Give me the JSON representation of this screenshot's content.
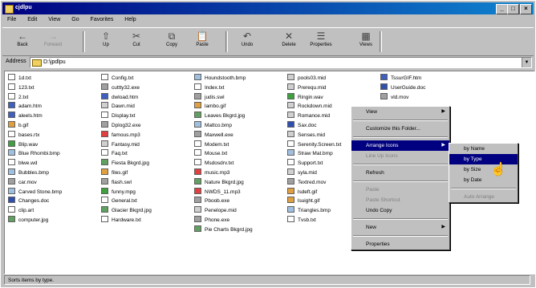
{
  "window": {
    "title": "cjdlpu"
  },
  "titlebar_buttons": [
    "_",
    "□",
    "×"
  ],
  "menubar": [
    "File",
    "Edit",
    "View",
    "Go",
    "Favorites",
    "Help"
  ],
  "toolbar": [
    {
      "label": "Back",
      "glyph": "←",
      "disabled": false
    },
    {
      "label": "Forward",
      "glyph": "→",
      "disabled": true
    },
    {
      "label": "Up",
      "glyph": "⇧",
      "disabled": false
    },
    {
      "label": "Cut",
      "glyph": "✂",
      "disabled": false
    },
    {
      "label": "Copy",
      "glyph": "⧉",
      "disabled": false
    },
    {
      "label": "Paste",
      "glyph": "📋",
      "disabled": false
    },
    {
      "label": "Undo",
      "glyph": "↶",
      "disabled": false
    },
    {
      "label": "Delete",
      "glyph": "✕",
      "disabled": false
    },
    {
      "label": "Properties",
      "glyph": "☰",
      "disabled": false
    },
    {
      "label": "Views",
      "glyph": "▦",
      "disabled": false
    }
  ],
  "address": {
    "label": "Address",
    "value": "D:\\jpdlpu"
  },
  "files": [
    [
      {
        "name": "1d.txt",
        "type": "txt"
      },
      {
        "name": "123.txt",
        "type": "txt"
      },
      {
        "name": "2.txt",
        "type": "txt"
      },
      {
        "name": "adam.htm",
        "type": "htm"
      },
      {
        "name": "aleels.htm",
        "type": "htm"
      },
      {
        "name": "b.gif",
        "type": "gif"
      },
      {
        "name": "bases.rtx",
        "type": "txt"
      },
      {
        "name": "Blip.wav",
        "type": "wav"
      },
      {
        "name": "Blue Rhombi.bmp",
        "type": "bmp"
      },
      {
        "name": "blwe.wd",
        "type": "txt"
      },
      {
        "name": "Bubbles.bmp",
        "type": "bmp"
      },
      {
        "name": "car.mov",
        "type": "exe"
      },
      {
        "name": "Carved Stone.bmp",
        "type": "bmp"
      },
      {
        "name": "Changes.doc",
        "type": "doc"
      },
      {
        "name": "clip.art",
        "type": "txt"
      },
      {
        "name": "computer.jpg",
        "type": "jpg"
      }
    ],
    [
      {
        "name": "Config.txt",
        "type": "txt"
      },
      {
        "name": "cuttty32.exe",
        "type": "exe"
      },
      {
        "name": "dwload.htm",
        "type": "htm"
      },
      {
        "name": "Dawn.mid",
        "type": "mid"
      },
      {
        "name": "Display.txt",
        "type": "txt"
      },
      {
        "name": "Dplog32.exe",
        "type": "exe"
      },
      {
        "name": "famous.mp3",
        "type": "mp3"
      },
      {
        "name": "Fantasy.mid",
        "type": "mid"
      },
      {
        "name": "Faq.txt",
        "type": "txt"
      },
      {
        "name": "Fiesta Bkgrd.jpg",
        "type": "jpg"
      },
      {
        "name": "files.gif",
        "type": "gif"
      },
      {
        "name": "flash.swl",
        "type": "exe"
      },
      {
        "name": "funny.mpg",
        "type": "wav"
      },
      {
        "name": "General.txt",
        "type": "txt"
      },
      {
        "name": "Glacier Bkgrd.jpg",
        "type": "jpg"
      },
      {
        "name": "Hardware.txt",
        "type": "txt"
      }
    ],
    [
      {
        "name": "Houndstooth.bmp",
        "type": "bmp"
      },
      {
        "name": "Index.txt",
        "type": "txt"
      },
      {
        "name": "judis.swl",
        "type": "exe"
      },
      {
        "name": "lambo.gif",
        "type": "gif"
      },
      {
        "name": "Leaves Bkgrd.jpg",
        "type": "jpg"
      },
      {
        "name": "Mattco.bmp",
        "type": "bmp"
      },
      {
        "name": "Maxwell.exe",
        "type": "exe"
      },
      {
        "name": "Modem.txt",
        "type": "txt"
      },
      {
        "name": "Mouse.txt",
        "type": "txt"
      },
      {
        "name": "Msdosdrv.txt",
        "type": "txt"
      },
      {
        "name": "music.mp3",
        "type": "mp3"
      },
      {
        "name": "Nature Bkgrd.jpg",
        "type": "jpg"
      },
      {
        "name": "NWDS_11.mp3",
        "type": "mp3"
      },
      {
        "name": "Pboob.exe",
        "type": "exe"
      },
      {
        "name": "Penelope.mid",
        "type": "mid"
      },
      {
        "name": "Phone.exe",
        "type": "exe"
      },
      {
        "name": "Pie Charts Bkgrd.jpg",
        "type": "jpg"
      }
    ],
    [
      {
        "name": "pools03.mid",
        "type": "mid"
      },
      {
        "name": "Prerequ.mid",
        "type": "mid"
      },
      {
        "name": "Ringin.wav",
        "type": "wav"
      },
      {
        "name": "Rockdown.mid",
        "type": "mid"
      },
      {
        "name": "Romance.mid",
        "type": "mid"
      },
      {
        "name": "Sax.doc",
        "type": "doc"
      },
      {
        "name": "Senses.mid",
        "type": "mid"
      },
      {
        "name": "Serenity.Screen.txt",
        "type": "txt"
      },
      {
        "name": "Straw Mat.bmp",
        "type": "bmp"
      },
      {
        "name": "Support.txt",
        "type": "txt"
      },
      {
        "name": "syla.mid",
        "type": "mid"
      },
      {
        "name": "Textred.mov",
        "type": "exe"
      },
      {
        "name": "lsdeft.gif",
        "type": "gif"
      },
      {
        "name": "lsuight.gif",
        "type": "gif"
      },
      {
        "name": "Triangles.bmp",
        "type": "bmp"
      },
      {
        "name": "Tvsb.txt",
        "type": "txt"
      }
    ],
    [
      {
        "name": "TssurGIF.htm",
        "type": "htm"
      },
      {
        "name": "UserGuide.doc",
        "type": "doc"
      },
      {
        "name": "vld.mov",
        "type": "exe"
      }
    ]
  ],
  "context_menu": [
    {
      "label": "View",
      "arrow": true
    },
    {
      "sep": true
    },
    {
      "label": "Customize this Folder..."
    },
    {
      "sep": true
    },
    {
      "label": "Arrange Icons",
      "arrow": true,
      "highlight": true
    },
    {
      "label": "Line Up Icons",
      "disabled": true
    },
    {
      "sep": true
    },
    {
      "label": "Refresh"
    },
    {
      "sep": true
    },
    {
      "label": "Paste",
      "disabled": true
    },
    {
      "label": "Paste Shortcut",
      "disabled": true
    },
    {
      "label": "Undo Copy"
    },
    {
      "sep": true
    },
    {
      "label": "New",
      "arrow": true
    },
    {
      "sep": true
    },
    {
      "label": "Properties"
    }
  ],
  "submenu": [
    {
      "label": "by Name"
    },
    {
      "label": "by Type",
      "highlight": true
    },
    {
      "label": "by Size"
    },
    {
      "label": "by Date"
    },
    {
      "sep": true
    },
    {
      "label": "Auto Arrange",
      "disabled": true
    }
  ],
  "status": {
    "text": "Sorts items by type."
  }
}
